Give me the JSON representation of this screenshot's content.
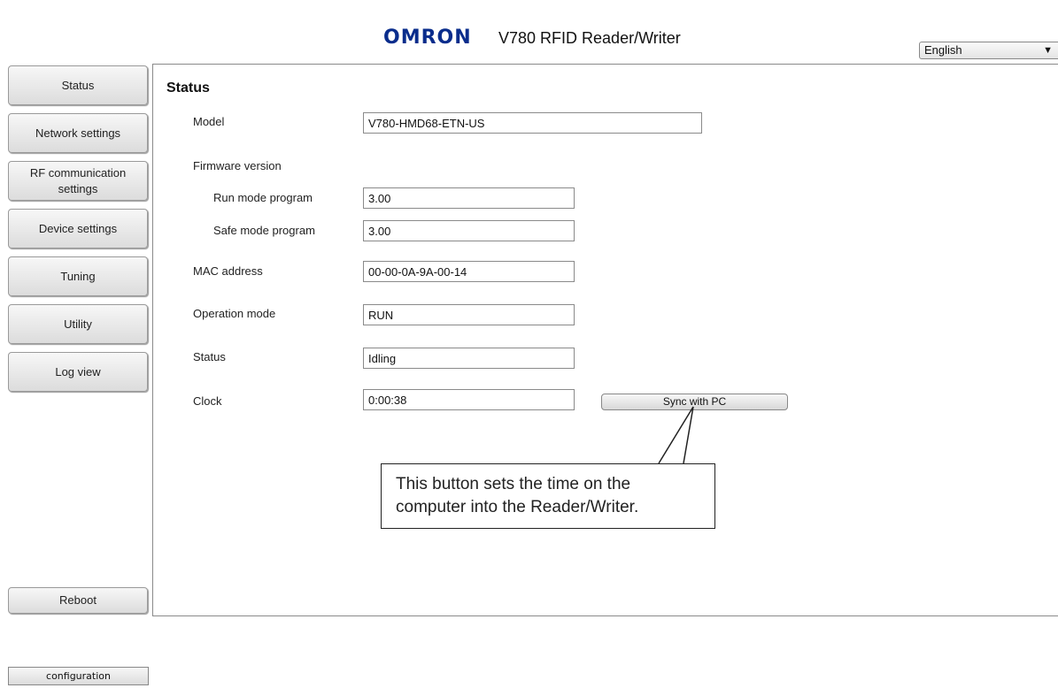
{
  "header": {
    "brand": "OMRON",
    "title": "V780 RFID Reader/Writer"
  },
  "language": {
    "selected": "English"
  },
  "nav": {
    "items": [
      {
        "label": "Status"
      },
      {
        "label": "Network settings"
      },
      {
        "label": "RF communication settings"
      },
      {
        "label": "Device settings"
      },
      {
        "label": "Tuning"
      },
      {
        "label": "Utility"
      },
      {
        "label": "Log view"
      }
    ],
    "reboot_label": "Reboot"
  },
  "main": {
    "title": "Status",
    "fields": {
      "model": {
        "label": "Model",
        "value": "V780-HMD68-ETN-US"
      },
      "firmware_heading": "Firmware version",
      "run_mode": {
        "label": "Run mode program",
        "value": "3.00"
      },
      "safe_mode": {
        "label": "Safe mode program",
        "value": "3.00"
      },
      "mac": {
        "label": "MAC address",
        "value": "00-00-0A-9A-00-14"
      },
      "operation_mode": {
        "label": "Operation mode",
        "value": "RUN"
      },
      "status": {
        "label": "Status",
        "value": "Idling"
      },
      "clock": {
        "label": "Clock",
        "value": "0:00:38"
      }
    },
    "sync_label": "Sync with PC"
  },
  "callout": {
    "line1": "This button sets the time on the",
    "line2": "computer into the Reader/Writer."
  },
  "footer": {
    "config_label": "configuration"
  },
  "colors": {
    "brand": "#0a2d8c"
  }
}
